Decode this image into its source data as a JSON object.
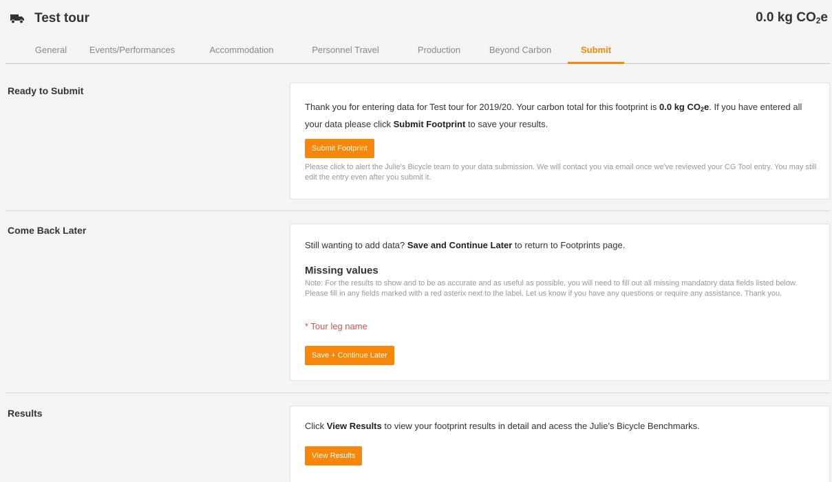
{
  "header": {
    "title": "Test tour",
    "total_value": "0.0 kg CO",
    "total_sub": "2",
    "total_suffix": "e",
    "icon": "truck-icon"
  },
  "tabs": [
    {
      "label": "General",
      "active": false
    },
    {
      "label": "Events/Performances",
      "active": false
    },
    {
      "label": "Accommodation",
      "active": false
    },
    {
      "label": "Personnel Travel",
      "active": false
    },
    {
      "label": "Production",
      "active": false
    },
    {
      "label": "Beyond Carbon",
      "active": false
    },
    {
      "label": "Submit",
      "active": true
    }
  ],
  "ready": {
    "label": "Ready to Submit",
    "text_1": "Thank you for entering data for Test tour for 2019/20. Your carbon total for this footprint is ",
    "total_bold": "0.0 kg CO",
    "total_sub": "2",
    "total_suffix": "e",
    "text_2": ". If you have entered all your data please click ",
    "action_bold": "Submit Footprint",
    "text_3": " to save your results.",
    "button_label": "Submit Footprint",
    "help": "Please click to alert the Julie's Bicycle team to your data submission. We will contact you via email once we've reviewed your CG Tool entry. You may still edit the entry even after you submit it."
  },
  "later": {
    "label": "Come Back Later",
    "text_1": "Still wanting to add data? ",
    "action_bold": "Save and Continue Later",
    "text_2": " to return to Footprints page.",
    "missing_title": "Missing values",
    "note": "Note: For the results to show and to be as accurate and as useful as possible, you will need to fill out all missing mandatory data fields listed below. Please fill in any fields marked with a red asterix next to the label. Let us know if you have any questions or require any assistance. Thank you.",
    "missing_item": "* Tour leg name",
    "button_label": "Save + Continue Later"
  },
  "results": {
    "label": "Results",
    "text_1": "Click ",
    "action_bold": "View Results",
    "text_2": " to view your footprint results in detail and acess the Julie's Bicycle Benchmarks.",
    "button_label": "View Results"
  },
  "colors": {
    "accent": "#f7870a",
    "error": "#d9534f"
  }
}
